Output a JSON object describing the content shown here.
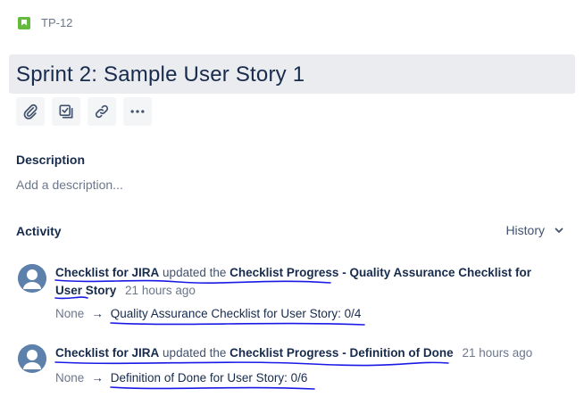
{
  "issue": {
    "key": "TP-12",
    "title": "Sprint 2: Sample User Story 1"
  },
  "toolbar": {
    "icons": [
      "paperclip-icon",
      "checklist-icon",
      "link-icon",
      "more-icon"
    ]
  },
  "description": {
    "label": "Description",
    "placeholder": "Add a description..."
  },
  "activity": {
    "label": "Activity",
    "history_label": "History",
    "entries": [
      {
        "actor": "Checklist for JIRA",
        "verb": "updated the",
        "field": "Checklist Progress - Quality Assurance Checklist for User Story",
        "time": "21 hours ago",
        "from": "None",
        "to": "Quality Assurance Checklist for User Story: 0/4"
      },
      {
        "actor": "Checklist for JIRA",
        "verb": "updated the",
        "field": "Checklist Progress - Definition of Done",
        "time": "21 hours ago",
        "from": "None",
        "to": "Definition of Done for User Story: 0/6"
      }
    ]
  },
  "colors": {
    "title_bg": "#ebecf0",
    "story_icon": "#63ba3c",
    "avatar": "#5e81ac",
    "annotation_ink": "#1a1ae6"
  }
}
